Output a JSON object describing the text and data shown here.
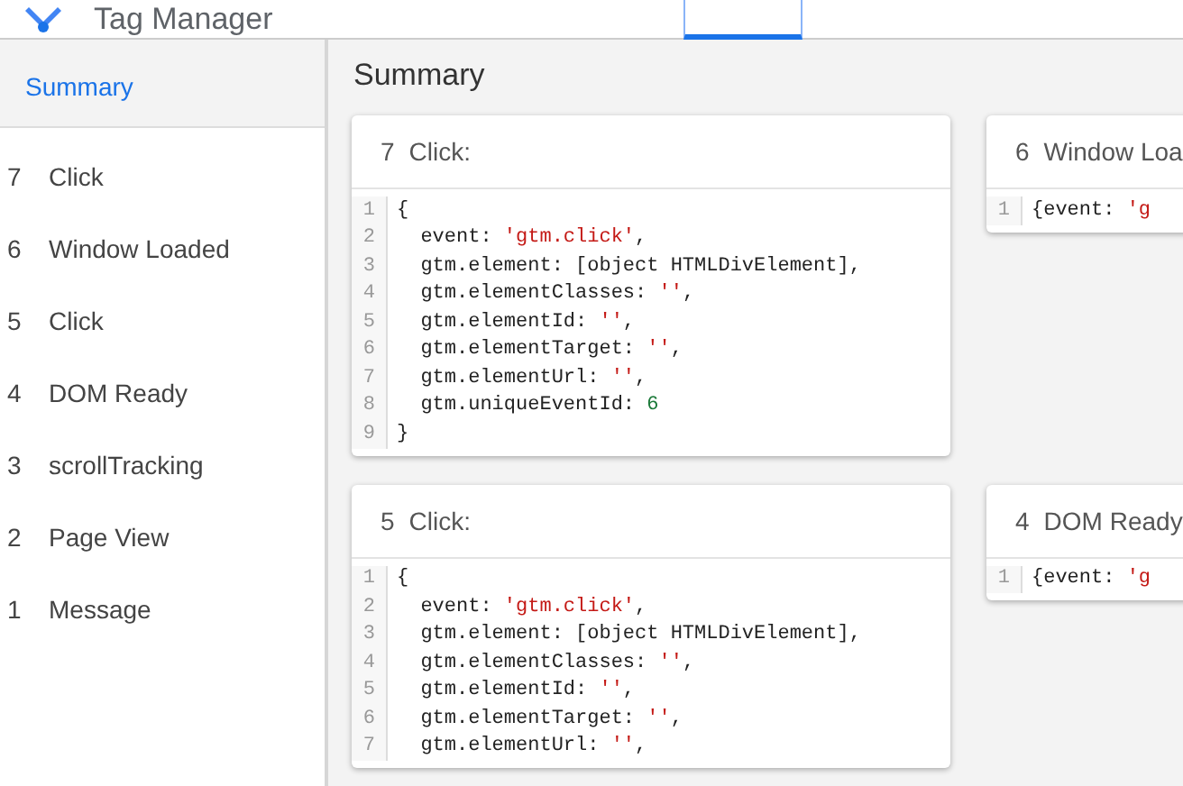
{
  "header": {
    "title": "Tag Manager"
  },
  "sidebar": {
    "items": [
      {
        "label": "Summary",
        "selected": true
      },
      {
        "number": "7",
        "label": "Click",
        "selected": false
      },
      {
        "number": "6",
        "label": "Window Loaded",
        "selected": false
      },
      {
        "number": "5",
        "label": "Click",
        "selected": false
      },
      {
        "number": "4",
        "label": "DOM Ready",
        "selected": false
      },
      {
        "number": "3",
        "label": "scrollTracking",
        "selected": false
      },
      {
        "number": "2",
        "label": "Page View",
        "selected": false
      },
      {
        "number": "1",
        "label": "Message",
        "selected": false
      }
    ]
  },
  "main": {
    "title": "Summary",
    "cards": [
      {
        "number": "7",
        "title": "Click:",
        "lines": [
          {
            "n": "1",
            "parts": [
              {
                "kind": "plain",
                "text": "{"
              }
            ]
          },
          {
            "n": "2",
            "parts": [
              {
                "kind": "plain",
                "text": "  event: "
              },
              {
                "kind": "string",
                "text": "'gtm.click'"
              },
              {
                "kind": "plain",
                "text": ","
              }
            ]
          },
          {
            "n": "3",
            "parts": [
              {
                "kind": "plain",
                "text": "  gtm.element: [object HTMLDivElement],"
              }
            ]
          },
          {
            "n": "4",
            "parts": [
              {
                "kind": "plain",
                "text": "  gtm.elementClasses: "
              },
              {
                "kind": "string",
                "text": "''"
              },
              {
                "kind": "plain",
                "text": ","
              }
            ]
          },
          {
            "n": "5",
            "parts": [
              {
                "kind": "plain",
                "text": "  gtm.elementId: "
              },
              {
                "kind": "string",
                "text": "''"
              },
              {
                "kind": "plain",
                "text": ","
              }
            ]
          },
          {
            "n": "6",
            "parts": [
              {
                "kind": "plain",
                "text": "  gtm.elementTarget: "
              },
              {
                "kind": "string",
                "text": "''"
              },
              {
                "kind": "plain",
                "text": ","
              }
            ]
          },
          {
            "n": "7",
            "parts": [
              {
                "kind": "plain",
                "text": "  gtm.elementUrl: "
              },
              {
                "kind": "string",
                "text": "''"
              },
              {
                "kind": "plain",
                "text": ","
              }
            ]
          },
          {
            "n": "8",
            "parts": [
              {
                "kind": "plain",
                "text": "  gtm.uniqueEventId: "
              },
              {
                "kind": "number",
                "text": "6"
              }
            ]
          },
          {
            "n": "9",
            "parts": [
              {
                "kind": "plain",
                "text": "}"
              }
            ]
          }
        ]
      },
      {
        "number": "6",
        "title": "Window Loa",
        "lines": [
          {
            "n": "1",
            "parts": [
              {
                "kind": "plain",
                "text": "{event: "
              },
              {
                "kind": "string",
                "text": "'g"
              }
            ]
          }
        ]
      },
      {
        "number": "5",
        "title": "Click:",
        "lines": [
          {
            "n": "1",
            "parts": [
              {
                "kind": "plain",
                "text": "{"
              }
            ]
          },
          {
            "n": "2",
            "parts": [
              {
                "kind": "plain",
                "text": "  event: "
              },
              {
                "kind": "string",
                "text": "'gtm.click'"
              },
              {
                "kind": "plain",
                "text": ","
              }
            ]
          },
          {
            "n": "3",
            "parts": [
              {
                "kind": "plain",
                "text": "  gtm.element: [object HTMLDivElement],"
              }
            ]
          },
          {
            "n": "4",
            "parts": [
              {
                "kind": "plain",
                "text": "  gtm.elementClasses: "
              },
              {
                "kind": "string",
                "text": "''"
              },
              {
                "kind": "plain",
                "text": ","
              }
            ]
          },
          {
            "n": "5",
            "parts": [
              {
                "kind": "plain",
                "text": "  gtm.elementId: "
              },
              {
                "kind": "string",
                "text": "''"
              },
              {
                "kind": "plain",
                "text": ","
              }
            ]
          },
          {
            "n": "6",
            "parts": [
              {
                "kind": "plain",
                "text": "  gtm.elementTarget: "
              },
              {
                "kind": "string",
                "text": "''"
              },
              {
                "kind": "plain",
                "text": ","
              }
            ]
          },
          {
            "n": "7",
            "parts": [
              {
                "kind": "plain",
                "text": "  gtm.elementUrl: "
              },
              {
                "kind": "string",
                "text": "''"
              },
              {
                "kind": "plain",
                "text": ","
              }
            ]
          }
        ]
      },
      {
        "number": "4",
        "title": "DOM Ready",
        "lines": [
          {
            "n": "1",
            "parts": [
              {
                "kind": "plain",
                "text": "{event: "
              },
              {
                "kind": "string",
                "text": "'g"
              }
            ]
          }
        ]
      }
    ]
  }
}
